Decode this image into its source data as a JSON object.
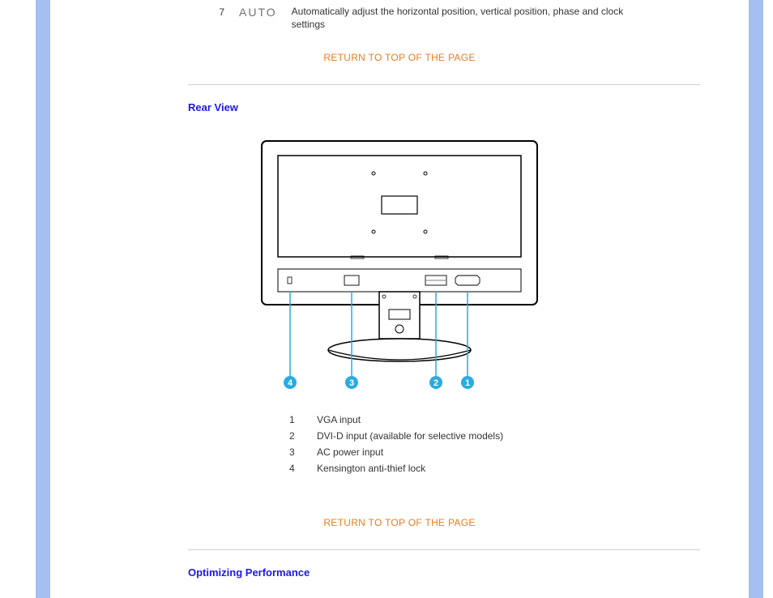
{
  "top_row": {
    "num": "7",
    "auto_label": "AUTO",
    "auto_desc": "Automatically adjust the horizontal position, vertical position, phase and clock settings"
  },
  "return_link_1": "RETURN TO TOP OF THE PAGE",
  "rear_view_heading": "Rear View",
  "legend": [
    {
      "num": "1",
      "label": "VGA input"
    },
    {
      "num": "2",
      "label": "DVI-D input (available for selective models)"
    },
    {
      "num": "3",
      "label": "AC power input"
    },
    {
      "num": "4",
      "label": "Kensington anti-thief lock"
    }
  ],
  "return_link_2": "RETURN TO TOP OF THE PAGE",
  "optimizing_heading": "Optimizing Performance",
  "callouts": [
    "4",
    "3",
    "2",
    "1"
  ]
}
